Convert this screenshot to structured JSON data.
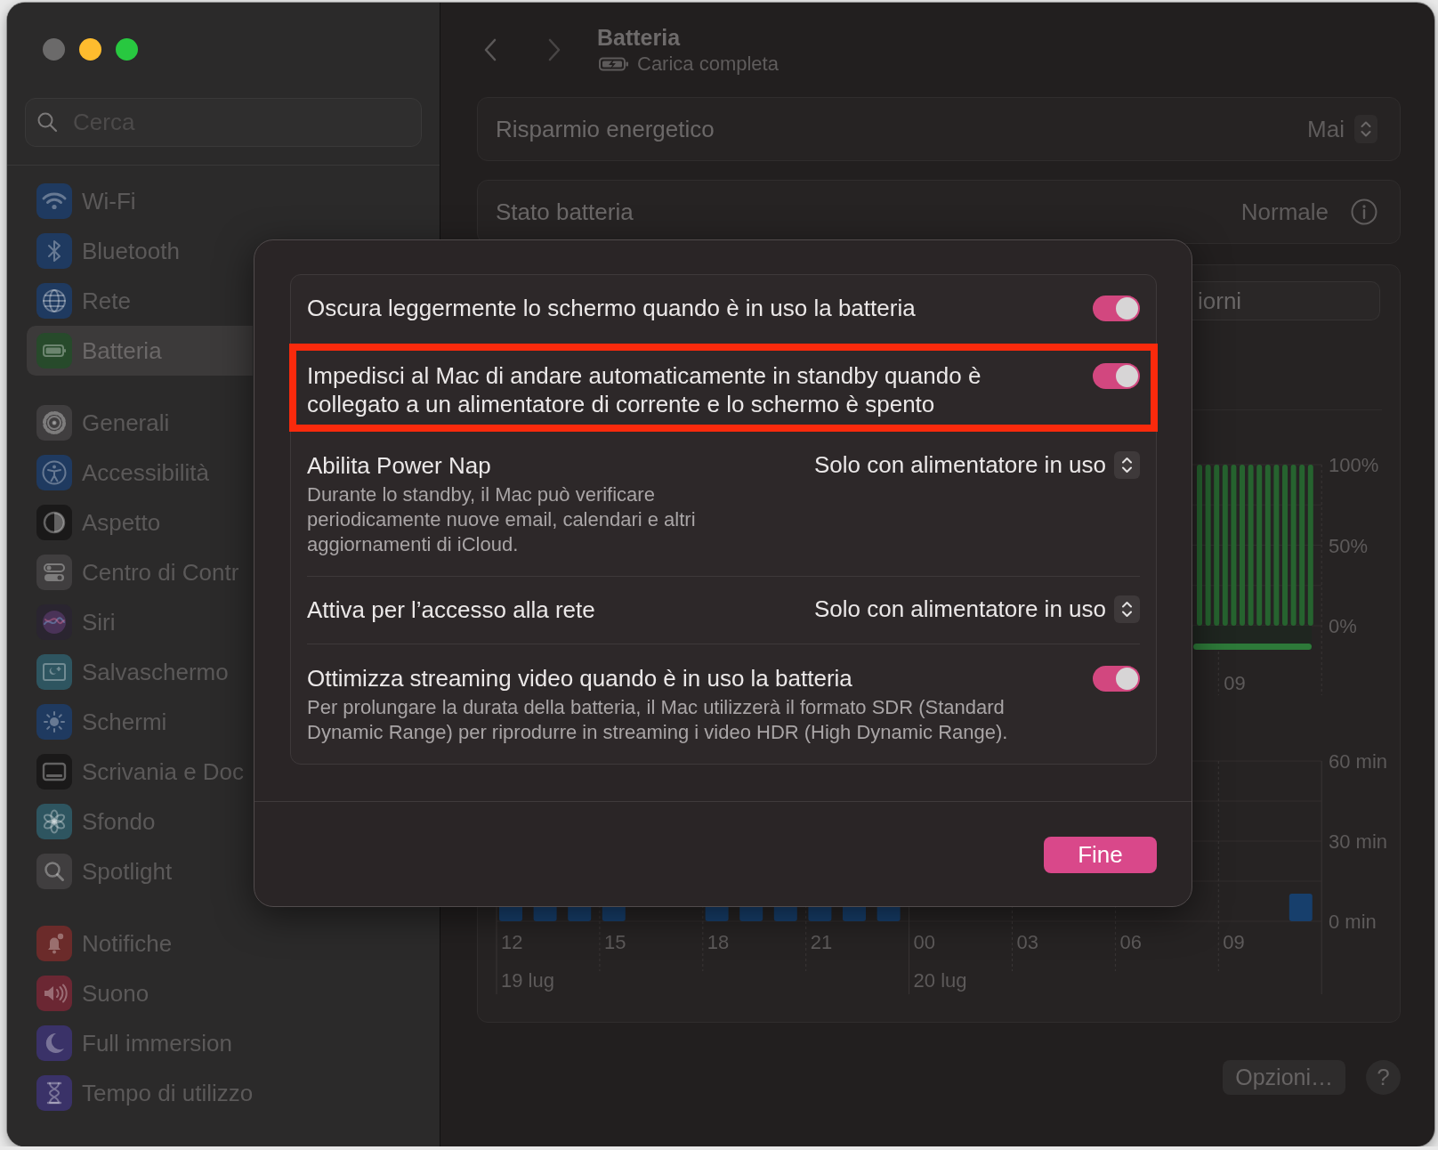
{
  "window": {
    "controls": [
      {
        "kind": "close",
        "disabled": true
      },
      {
        "kind": "minimize",
        "disabled": false
      },
      {
        "kind": "zoom",
        "disabled": false
      }
    ]
  },
  "sidebar": {
    "search": {
      "placeholder": "Cerca"
    },
    "groups": [
      [
        {
          "kind": "wifi",
          "label": "Wi-Fi",
          "selected": false
        },
        {
          "kind": "bluetooth",
          "label": "Bluetooth",
          "selected": false
        },
        {
          "kind": "network",
          "label": "Rete",
          "selected": false
        },
        {
          "kind": "battery",
          "label": "Batteria",
          "selected": true
        }
      ],
      [
        {
          "kind": "general",
          "label": "Generali",
          "selected": false
        },
        {
          "kind": "accessibility",
          "label": "Accessibilità",
          "selected": false
        },
        {
          "kind": "appearance",
          "label": "Aspetto",
          "selected": false
        },
        {
          "kind": "control",
          "label": "Centro di Contr",
          "selected": false
        },
        {
          "kind": "siri",
          "label": "Siri",
          "selected": false
        },
        {
          "kind": "screensaver",
          "label": "Salvaschermo",
          "selected": false
        },
        {
          "kind": "displays",
          "label": "Schermi",
          "selected": false
        },
        {
          "kind": "dock",
          "label": "Scrivania e Doc",
          "selected": false
        },
        {
          "kind": "wallpaper",
          "label": "Sfondo",
          "selected": false
        },
        {
          "kind": "spotlight",
          "label": "Spotlight",
          "selected": false
        }
      ],
      [
        {
          "kind": "notifications",
          "label": "Notifiche",
          "selected": false
        },
        {
          "kind": "sound",
          "label": "Suono",
          "selected": false
        },
        {
          "kind": "focus",
          "label": "Full immersion",
          "selected": false
        },
        {
          "kind": "screentime",
          "label": "Tempo di utilizzo",
          "selected": false
        }
      ]
    ]
  },
  "header": {
    "title": "Batteria",
    "subtitle": "Carica completa"
  },
  "settings": [
    {
      "kind": "popup",
      "label": "Risparmio energetico",
      "value": "Mai"
    },
    {
      "kind": "info",
      "label": "Stato batteria",
      "value": "Normale"
    }
  ],
  "history": {
    "range_segment": "iorni",
    "battery_chart": {
      "y_labels": [
        "100%",
        "50%",
        "0%"
      ],
      "x_labels": [
        "09"
      ]
    },
    "usage_chart": {
      "y_labels": [
        "60 min",
        "30 min",
        "0 min"
      ],
      "x_labels": [
        "12",
        "15",
        "18",
        "21",
        "00",
        "03",
        "06",
        "09"
      ],
      "date_labels": [
        "19 lug",
        "20 lug"
      ]
    }
  },
  "footer": {
    "options_button": "Opzioni…",
    "help_button": "?"
  },
  "sheet": {
    "rows": [
      {
        "kind": "toggle",
        "label": "Oscura leggermente lo schermo quando è in uso la batteria",
        "on": true,
        "highlighted": false
      },
      {
        "kind": "toggle",
        "label": "Impedisci al Mac di andare automaticamente in standby quando è collegato a un alimentatore di corrente e lo schermo è spento",
        "on": true,
        "highlighted": true
      },
      {
        "kind": "popup",
        "label": "Abilita Power Nap",
        "description": "Durante lo standby, il Mac può verificare periodicamente nuove email, calendari e altri aggiornamenti di iCloud.",
        "value": "Solo con alimentatore in uso",
        "highlighted": false
      },
      {
        "kind": "popup",
        "label": "Attiva per l’accesso alla rete",
        "value": "Solo con alimentatore in uso",
        "highlighted": false
      },
      {
        "kind": "toggle",
        "label": "Ottimizza streaming video quando è in uso la batteria",
        "description": "Per prolungare la durata della batteria, il Mac utilizzerà il formato SDR (Standard Dynamic Range) per riprodurre in streaming i video HDR (High Dynamic Range).",
        "on": true,
        "highlighted": false
      }
    ],
    "done_button": "Fine"
  }
}
